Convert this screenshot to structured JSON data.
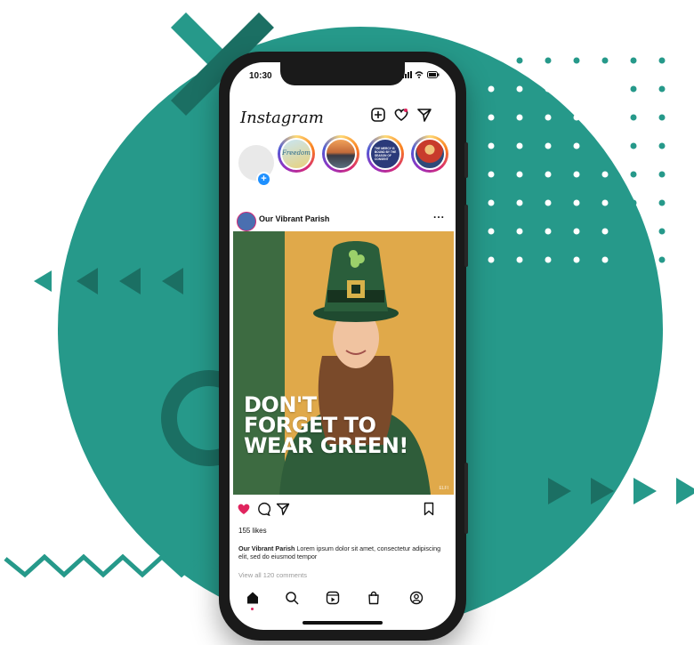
{
  "status_bar": {
    "time": "10:30"
  },
  "app": {
    "logo_text": "Instagram"
  },
  "header_icons": [
    "add-post-icon",
    "heart-icon",
    "direct-message-icon"
  ],
  "stories": [
    {
      "name": "your-story",
      "label": ""
    },
    {
      "name": "story-freedom",
      "text": "Freedom"
    },
    {
      "name": "story-landscape",
      "text": ""
    },
    {
      "name": "story-mercy",
      "text": "THE MERCY IS BOUND BY THE SEASON OF CONSENT"
    },
    {
      "name": "story-saint",
      "text": ""
    }
  ],
  "post": {
    "username": "Our Vibrant Parish",
    "more": "...",
    "headline_lines": [
      "DON'T",
      "FORGET TO",
      "WEAR GREEN!"
    ],
    "image_watermark": "ELFI",
    "likes": "155 likes",
    "caption_user": "Our Vibrant Parish",
    "caption_text": "Lorem ipsum dolor sit amet, consectetur adipiscing elit, sed do eiusmod tempor",
    "view_comments": "View all 120 comments",
    "liked": true
  },
  "bottom_nav": [
    "home-icon",
    "search-icon",
    "reels-icon",
    "shop-icon",
    "profile-icon"
  ],
  "colors": {
    "teal": "#26998a",
    "dark_teal": "#1b6f63",
    "like_red": "#e0245e",
    "post_green": "#3d6b41",
    "post_gold": "#e0a94a"
  }
}
